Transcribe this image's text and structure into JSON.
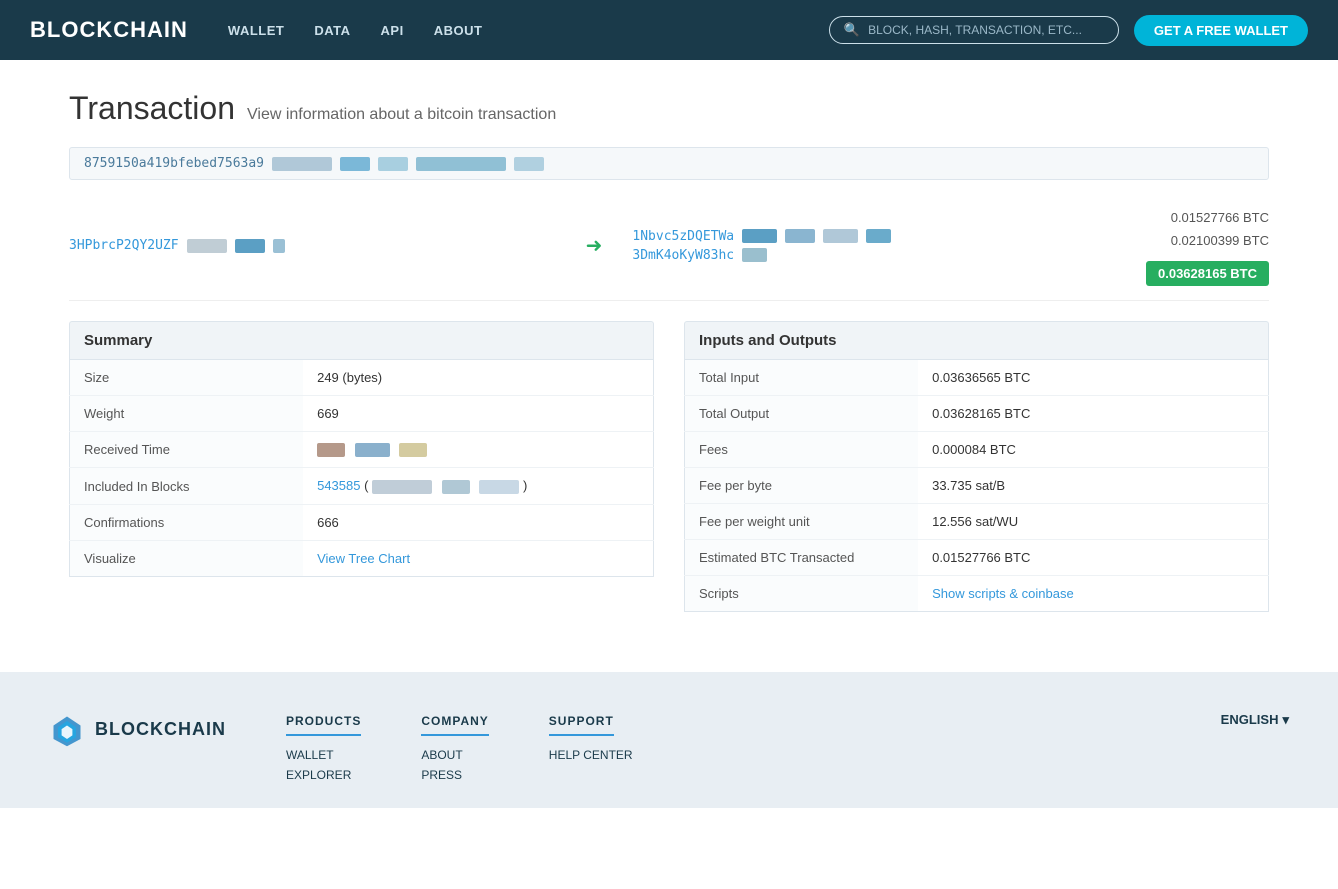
{
  "navbar": {
    "brand": "BLOCKCHAIN",
    "links": [
      "WALLET",
      "DATA",
      "API",
      "ABOUT"
    ],
    "search_placeholder": "BLOCK, HASH, TRANSACTION, ETC...",
    "cta_button": "GET A FREE WALLET"
  },
  "page": {
    "title": "Transaction",
    "subtitle": "View information about a bitcoin transaction"
  },
  "transaction": {
    "hash_partial": "8759150a419bfebed7563a9",
    "from_address": "3HPbrcP2QY2UZF",
    "to_addresses": [
      "1Nbvc5zDQETWa",
      "3DmK4oKyW83hc"
    ],
    "amount1": "0.01527766 BTC",
    "amount2": "0.02100399 BTC",
    "total": "0.03628165 BTC",
    "arrow": "➜"
  },
  "summary": {
    "header": "Summary",
    "rows": [
      {
        "label": "Size",
        "value": "249 (bytes)"
      },
      {
        "label": "Weight",
        "value": "669"
      },
      {
        "label": "Received Time",
        "value": ""
      },
      {
        "label": "Included In Blocks",
        "value": "543585"
      },
      {
        "label": "Confirmations",
        "value": "666"
      },
      {
        "label": "Visualize",
        "value": "View Tree Chart"
      }
    ]
  },
  "inputs_outputs": {
    "header": "Inputs and Outputs",
    "rows": [
      {
        "label": "Total Input",
        "value": "0.03636565 BTC"
      },
      {
        "label": "Total Output",
        "value": "0.03628165 BTC"
      },
      {
        "label": "Fees",
        "value": "0.000084 BTC"
      },
      {
        "label": "Fee per byte",
        "value": "33.735 sat/B"
      },
      {
        "label": "Fee per weight unit",
        "value": "12.556 sat/WU"
      },
      {
        "label": "Estimated BTC Transacted",
        "value": "0.01527766 BTC"
      },
      {
        "label": "Scripts",
        "value": "Show scripts & coinbase"
      }
    ]
  },
  "footer": {
    "brand": "BLOCKCHAIN",
    "columns": [
      {
        "header": "PRODUCTS",
        "links": [
          "WALLET",
          "EXPLORER"
        ]
      },
      {
        "header": "COMPANY",
        "links": [
          "ABOUT",
          "PRESS"
        ]
      },
      {
        "header": "SUPPORT",
        "links": [
          "HELP CENTER"
        ]
      }
    ],
    "language": "ENGLISH"
  }
}
